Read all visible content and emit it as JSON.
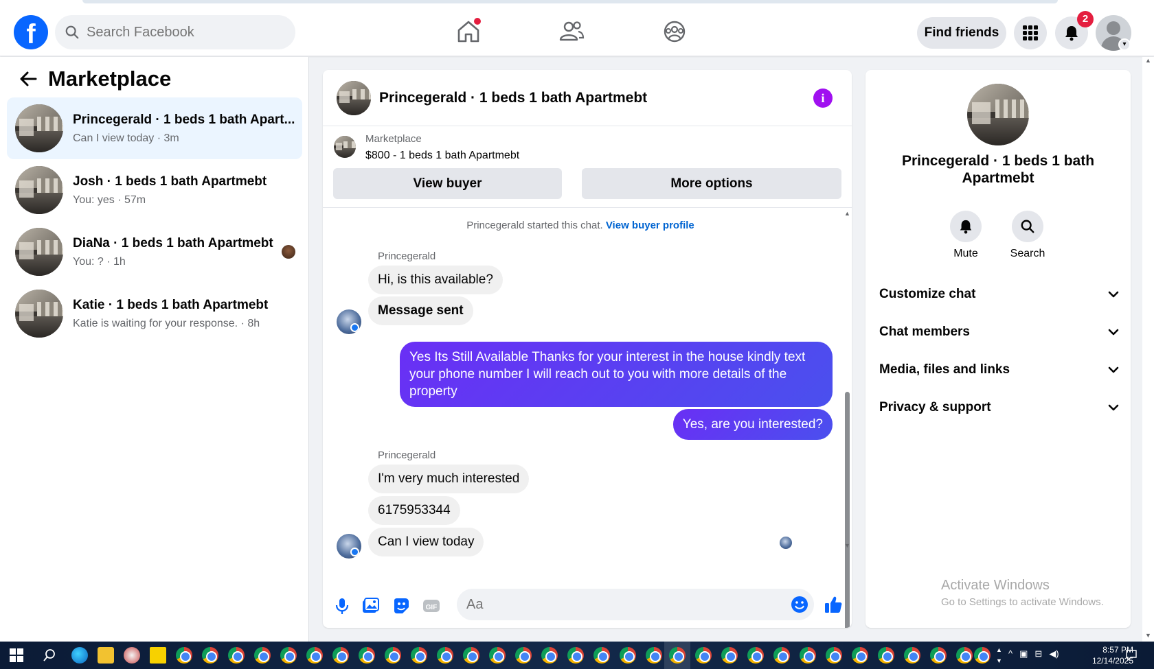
{
  "topnav": {
    "logo": "f",
    "search_placeholder": "Search Facebook",
    "find_friends": "Find friends",
    "notifications_count": "2"
  },
  "sidebar": {
    "title": "Marketplace",
    "conversations": [
      {
        "name": "Princegerald · 1 beds 1 bath Apart...",
        "sub": "Can I view today · 3m"
      },
      {
        "name": "Josh · 1 beds 1 bath Apartmebt",
        "sub": "You: yes · 57m"
      },
      {
        "name": "DiaNa · 1 beds 1 bath Apartmebt",
        "sub": "You: ? · 1h"
      },
      {
        "name": "Katie · 1 beds 1 bath Apartmebt",
        "sub": "Katie is waiting for your response. · 8h"
      }
    ]
  },
  "chat": {
    "title": "Princegerald · 1 beds 1 bath Apartmebt",
    "info_icon": "i",
    "marketplace_label": "Marketplace",
    "listing": "$800 - 1 beds 1 bath Apartmebt",
    "view_buyer": "View buyer",
    "more_options": "More options",
    "started_text": "Princegerald started this chat.",
    "view_buyer_profile": "View buyer profile",
    "messages": {
      "sender1": "Princegerald",
      "m1": "Hi, is this available?",
      "m2": "Message sent",
      "m3": "Yes Its Still Available Thanks for your interest in the house kindly text your phone number I will reach out to you with more details of the property",
      "m4": "Yes, are you interested?",
      "sender2": "Princegerald",
      "m5": "I'm very much interested",
      "m6": "6175953344",
      "m7": "Can I view today"
    },
    "composer_placeholder": "Aa"
  },
  "info_panel": {
    "name": "Princegerald · 1 beds 1 bath Apartmebt",
    "mute": "Mute",
    "search": "Search",
    "sections": [
      "Customize chat",
      "Chat members",
      "Media, files and links",
      "Privacy & support"
    ]
  },
  "watermark": {
    "line1": "Activate Windows",
    "line2": "Go to Settings to activate Windows."
  },
  "taskbar": {
    "time": "8:57 PM",
    "date": "12/14/2025"
  },
  "colors": {
    "brand": "#0866ff",
    "outgoing_bubble": "#5b3cf5",
    "info_icon": "#a010f0",
    "badge": "#e41e3f"
  }
}
